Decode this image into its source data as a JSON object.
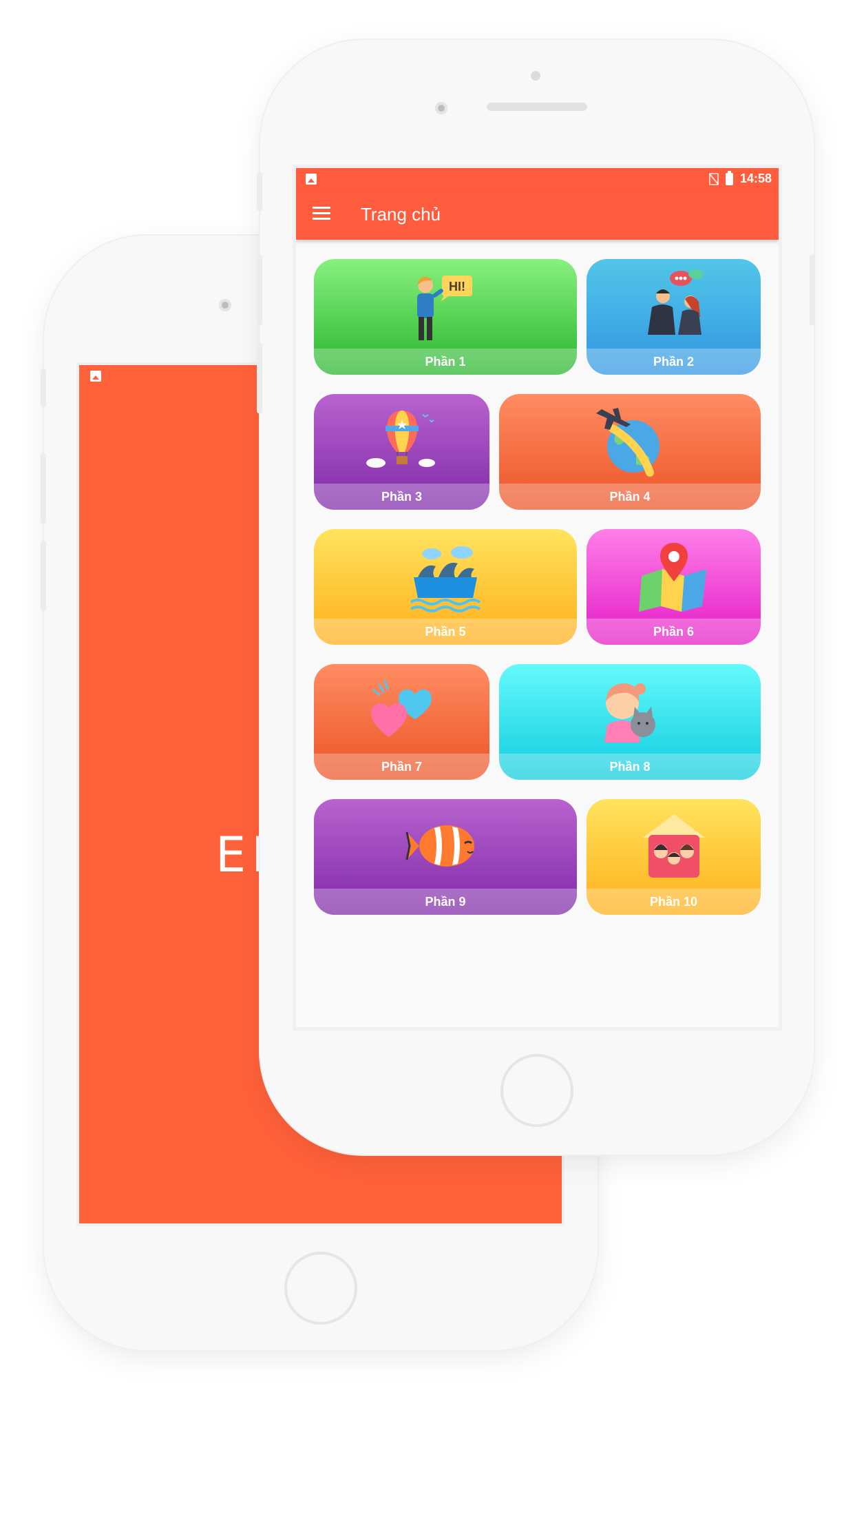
{
  "back_screen": {
    "splash_text": "EN",
    "color": "#ff613a"
  },
  "status_bar": {
    "time": "14:58",
    "icons": [
      "gallery-icon",
      "no-sim-icon",
      "battery-icon"
    ]
  },
  "toolbar": {
    "title": "Trang chủ",
    "menu_icon": "menu-icon",
    "color": "#ff5c3e"
  },
  "parts": [
    {
      "label": "Phần 1",
      "icon": "hi-person-icon",
      "color": "green"
    },
    {
      "label": "Phần 2",
      "icon": "business-chat-icon",
      "color": "blue"
    },
    {
      "label": "Phần 3",
      "icon": "hot-air-balloon-icon",
      "color": "purple"
    },
    {
      "label": "Phần 4",
      "icon": "plane-globe-icon",
      "color": "orange"
    },
    {
      "label": "Phần 5",
      "icon": "dolphins-icon",
      "color": "yellow"
    },
    {
      "label": "Phần 6",
      "icon": "map-pin-icon",
      "color": "pink"
    },
    {
      "label": "Phần 7",
      "icon": "hearts-icon",
      "color": "orange"
    },
    {
      "label": "Phần 8",
      "icon": "girl-cat-icon",
      "color": "cyan"
    },
    {
      "label": "Phần 9",
      "icon": "clownfish-icon",
      "color": "purple"
    },
    {
      "label": "Phần 10",
      "icon": "family-house-icon",
      "color": "yellow"
    }
  ]
}
